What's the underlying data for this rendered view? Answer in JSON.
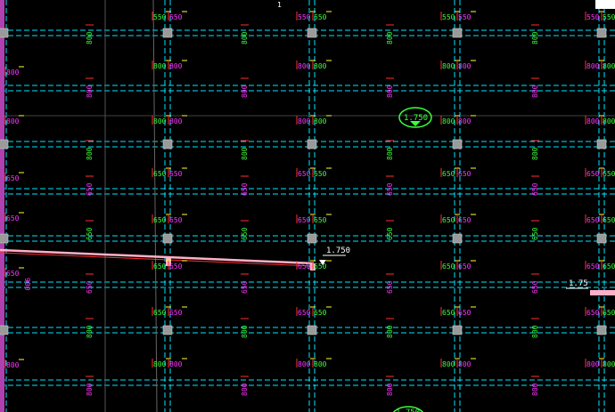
{
  "drawing": {
    "colors": {
      "background": "#000000",
      "gridline": "#00e5ff",
      "dim_green": "#3cff3c",
      "dim_magenta": "#ff33ff",
      "column": "#9a9a9a",
      "leader_red": "#ff3030",
      "tick_yellow": "#ffff33",
      "beam_pink": "#ffb0c8",
      "level_white": "#ffffff"
    },
    "levels": {
      "main": "1.750",
      "right": "1.75",
      "marker_top": "1"
    },
    "labels": [
      "550",
      "650",
      "800"
    ],
    "edge_label": "900"
  }
}
